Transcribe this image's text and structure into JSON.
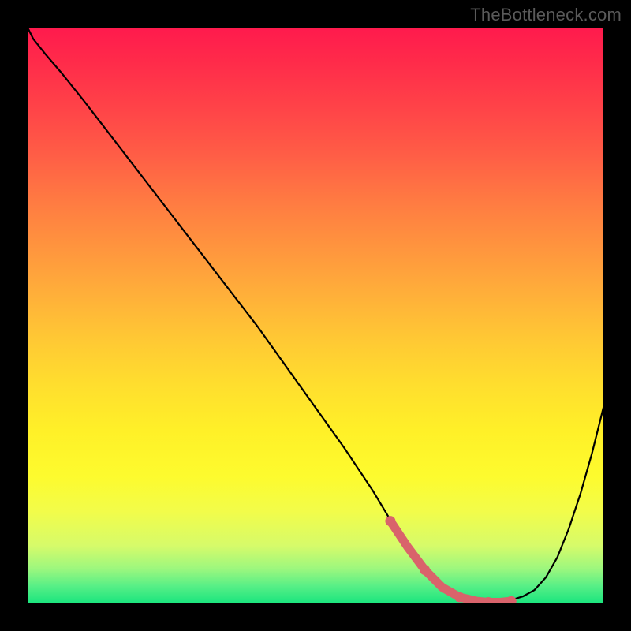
{
  "watermark": "TheBottleneck.com",
  "colors": {
    "curve": "#000000",
    "highlight": "#d9636b",
    "frame": "#000000"
  },
  "chart_data": {
    "type": "line",
    "title": "",
    "xlabel": "",
    "ylabel": "",
    "xlim": [
      0,
      100
    ],
    "ylim": [
      0,
      100
    ],
    "series": [
      {
        "name": "bottleneck-curve",
        "x": [
          0,
          1,
          3,
          6,
          10,
          15,
          20,
          25,
          30,
          35,
          40,
          45,
          50,
          55,
          60,
          63,
          66,
          69,
          72,
          75,
          78,
          80,
          82,
          84,
          86,
          88,
          90,
          92,
          94,
          96,
          98,
          100
        ],
        "y": [
          100,
          98,
          95.5,
          92,
          87,
          80.5,
          74,
          67.5,
          61,
          54.5,
          48,
          41,
          34,
          27,
          19.5,
          14.5,
          10,
          6,
          3,
          1.3,
          0.6,
          0.4,
          0.4,
          0.6,
          1.2,
          2.3,
          4.5,
          8,
          13,
          19,
          26,
          34
        ]
      }
    ],
    "highlight": {
      "name": "optimum-range",
      "x": [
        63,
        66,
        69,
        72,
        75,
        78,
        80,
        82,
        84
      ],
      "y": [
        14.5,
        10,
        6,
        3,
        1.3,
        0.6,
        0.4,
        0.4,
        0.6
      ],
      "dots_x": [
        63,
        69,
        75,
        80,
        84
      ],
      "dots_y": [
        14.5,
        6,
        1.3,
        0.4,
        0.6
      ]
    }
  }
}
